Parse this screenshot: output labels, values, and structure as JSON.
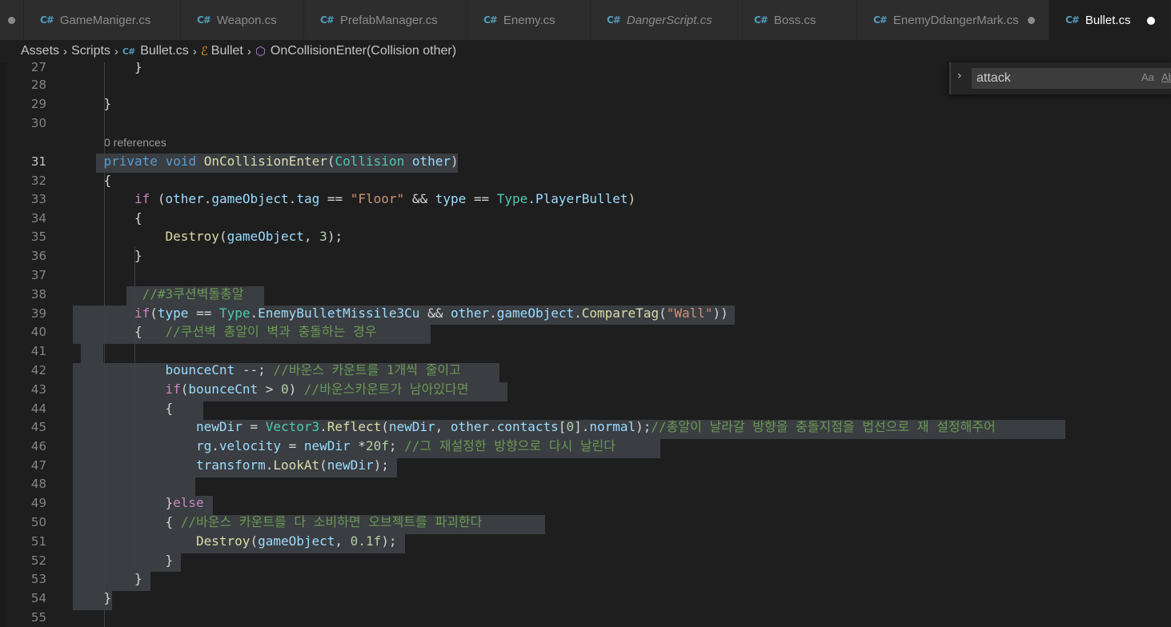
{
  "tabs": [
    {
      "name": "GameManiger.cs",
      "italic": false,
      "modified": false
    },
    {
      "name": "Weapon.cs",
      "italic": false,
      "modified": false
    },
    {
      "name": "PrefabManager.cs",
      "italic": false,
      "modified": false
    },
    {
      "name": "Enemy.cs",
      "italic": false,
      "modified": false
    },
    {
      "name": "DangerScript.cs",
      "italic": true,
      "modified": false
    },
    {
      "name": "Boss.cs",
      "italic": false,
      "modified": false
    },
    {
      "name": "EnemyDdangerMark.cs",
      "italic": false,
      "modified": true
    },
    {
      "name": "Bullet.cs",
      "italic": false,
      "modified": true,
      "active": true
    }
  ],
  "tab_icon_text": "C#",
  "breadcrumb": {
    "folder1": "Assets",
    "folder2": "Scripts",
    "file": "Bullet.cs",
    "class": "Bullet",
    "method": "OnCollisionEnter(Collision other)"
  },
  "find": {
    "value": "attack",
    "match_case": "Aa",
    "whole_word": "Ab"
  },
  "codelens": "0 references",
  "code_lines": [
    {
      "n": "27",
      "indent": 2,
      "tokens": [
        [
          "p",
          "}"
        ]
      ]
    },
    {
      "n": "28",
      "indent": 0,
      "tokens": []
    },
    {
      "n": "29",
      "indent": 1,
      "tokens": [
        [
          "p",
          "}"
        ]
      ]
    },
    {
      "n": "30",
      "indent": 0,
      "tokens": []
    },
    {
      "n": "31",
      "indent": 1,
      "tokens": [
        [
          "kw",
          "private"
        ],
        [
          "p",
          " "
        ],
        [
          "kw",
          "void"
        ],
        [
          "p",
          " "
        ],
        [
          "fn",
          "OnCollisionEnter"
        ],
        [
          "p",
          "("
        ],
        [
          "ty",
          "Collision"
        ],
        [
          "p",
          " "
        ],
        [
          "var",
          "other"
        ],
        [
          "p",
          ")"
        ]
      ]
    },
    {
      "n": "32",
      "indent": 1,
      "tokens": [
        [
          "p",
          "{"
        ]
      ]
    },
    {
      "n": "33",
      "indent": 2,
      "tokens": [
        [
          "ctl",
          "if"
        ],
        [
          "p",
          " ("
        ],
        [
          "var",
          "other"
        ],
        [
          "p",
          "."
        ],
        [
          "var",
          "gameObject"
        ],
        [
          "p",
          "."
        ],
        [
          "var",
          "tag"
        ],
        [
          "p",
          " == "
        ],
        [
          "str",
          "\"Floor\""
        ],
        [
          "p",
          " && "
        ],
        [
          "var",
          "type"
        ],
        [
          "p",
          " == "
        ],
        [
          "ty",
          "Type"
        ],
        [
          "p",
          "."
        ],
        [
          "var",
          "PlayerBullet"
        ],
        [
          "p",
          ")"
        ]
      ]
    },
    {
      "n": "34",
      "indent": 2,
      "tokens": [
        [
          "p",
          "{"
        ]
      ]
    },
    {
      "n": "35",
      "indent": 3,
      "tokens": [
        [
          "fn",
          "Destroy"
        ],
        [
          "p",
          "("
        ],
        [
          "var",
          "gameObject"
        ],
        [
          "p",
          ", "
        ],
        [
          "num",
          "3"
        ],
        [
          "p",
          ");"
        ]
      ]
    },
    {
      "n": "36",
      "indent": 2,
      "tokens": [
        [
          "p",
          "}"
        ]
      ]
    },
    {
      "n": "37",
      "indent": 0,
      "tokens": []
    },
    {
      "n": "38",
      "indent": 2,
      "tokens": [
        [
          "cmt",
          " //#3쿠션벽돌총알"
        ]
      ]
    },
    {
      "n": "39",
      "indent": 2,
      "tokens": [
        [
          "ctl",
          "if"
        ],
        [
          "p",
          "("
        ],
        [
          "var",
          "type"
        ],
        [
          "p",
          " == "
        ],
        [
          "ty",
          "Type"
        ],
        [
          "p",
          "."
        ],
        [
          "var",
          "EnemyBulletMissile3Cu"
        ],
        [
          "p",
          " && "
        ],
        [
          "var",
          "other"
        ],
        [
          "p",
          "."
        ],
        [
          "var",
          "gameObject"
        ],
        [
          "p",
          "."
        ],
        [
          "fn",
          "CompareTag"
        ],
        [
          "p",
          "("
        ],
        [
          "str",
          "\"Wall\""
        ],
        [
          "p",
          "))"
        ]
      ]
    },
    {
      "n": "40",
      "indent": 2,
      "tokens": [
        [
          "p",
          "{   "
        ],
        [
          "cmt",
          "//쿠션벽 총알이 벽과 충돌하는 경우"
        ]
      ]
    },
    {
      "n": "41",
      "indent": 0,
      "tokens": []
    },
    {
      "n": "42",
      "indent": 3,
      "tokens": [
        [
          "var",
          "bounceCnt"
        ],
        [
          "p",
          " --; "
        ],
        [
          "cmt",
          "//바운스 카운트를 1개씩 줄이고"
        ]
      ]
    },
    {
      "n": "43",
      "indent": 3,
      "tokens": [
        [
          "ctl",
          "if"
        ],
        [
          "p",
          "("
        ],
        [
          "var",
          "bounceCnt"
        ],
        [
          "p",
          " > "
        ],
        [
          "num",
          "0"
        ],
        [
          "p",
          ") "
        ],
        [
          "cmt",
          "//바운스카운트가 남아있다면"
        ]
      ]
    },
    {
      "n": "44",
      "indent": 3,
      "tokens": [
        [
          "p",
          "{"
        ]
      ]
    },
    {
      "n": "45",
      "indent": 4,
      "tokens": [
        [
          "var",
          "newDir"
        ],
        [
          "p",
          " = "
        ],
        [
          "ty",
          "Vector3"
        ],
        [
          "p",
          "."
        ],
        [
          "fn",
          "Reflect"
        ],
        [
          "p",
          "("
        ],
        [
          "var",
          "newDir"
        ],
        [
          "p",
          ", "
        ],
        [
          "var",
          "other"
        ],
        [
          "p",
          "."
        ],
        [
          "var",
          "contacts"
        ],
        [
          "p",
          "["
        ],
        [
          "num",
          "0"
        ],
        [
          "p",
          "]."
        ],
        [
          "var",
          "normal"
        ],
        [
          "p",
          ");"
        ],
        [
          "cmt",
          "//총알이 날라갈 방향을 충돌지점을 법선으로 재 설정해주어"
        ]
      ]
    },
    {
      "n": "46",
      "indent": 4,
      "tokens": [
        [
          "var",
          "rg"
        ],
        [
          "p",
          "."
        ],
        [
          "var",
          "velocity"
        ],
        [
          "p",
          " = "
        ],
        [
          "var",
          "newDir"
        ],
        [
          "p",
          " *"
        ],
        [
          "num",
          "20f"
        ],
        [
          "p",
          "; "
        ],
        [
          "cmt",
          "//그 재설정한 방향으로 다시 날린다"
        ]
      ]
    },
    {
      "n": "47",
      "indent": 4,
      "tokens": [
        [
          "var",
          "transform"
        ],
        [
          "p",
          "."
        ],
        [
          "fn",
          "LookAt"
        ],
        [
          "p",
          "("
        ],
        [
          "var",
          "newDir"
        ],
        [
          "p",
          ");"
        ]
      ]
    },
    {
      "n": "48",
      "indent": 0,
      "tokens": []
    },
    {
      "n": "49",
      "indent": 3,
      "tokens": [
        [
          "p",
          "}"
        ],
        [
          "ctl",
          "else"
        ]
      ]
    },
    {
      "n": "50",
      "indent": 3,
      "tokens": [
        [
          "p",
          "{ "
        ],
        [
          "cmt",
          "//바운스 카운트를 다 소비하면 오브젝트를 파괴한다"
        ]
      ]
    },
    {
      "n": "51",
      "indent": 4,
      "tokens": [
        [
          "fn",
          "Destroy"
        ],
        [
          "p",
          "("
        ],
        [
          "var",
          "gameObject"
        ],
        [
          "p",
          ", "
        ],
        [
          "num",
          "0.1f"
        ],
        [
          "p",
          ");"
        ]
      ]
    },
    {
      "n": "52",
      "indent": 3,
      "tokens": [
        [
          "p",
          "}"
        ]
      ]
    },
    {
      "n": "53",
      "indent": 2,
      "tokens": [
        [
          "p",
          "}"
        ]
      ]
    },
    {
      "n": "54",
      "indent": 1,
      "tokens": [
        [
          "p",
          "}"
        ]
      ]
    },
    {
      "n": "55",
      "indent": 0,
      "tokens": []
    }
  ],
  "current_line": "31",
  "colors": {
    "keyword": "#569cd6",
    "control": "#c586c0",
    "function": "#dcdcaa",
    "type": "#4ec9b0",
    "variable": "#9cdcfe",
    "string": "#ce9178",
    "number": "#b5cea8",
    "comment": "#6a9955",
    "selection": "#3a3d41",
    "csharp_icon": "#519aba"
  }
}
